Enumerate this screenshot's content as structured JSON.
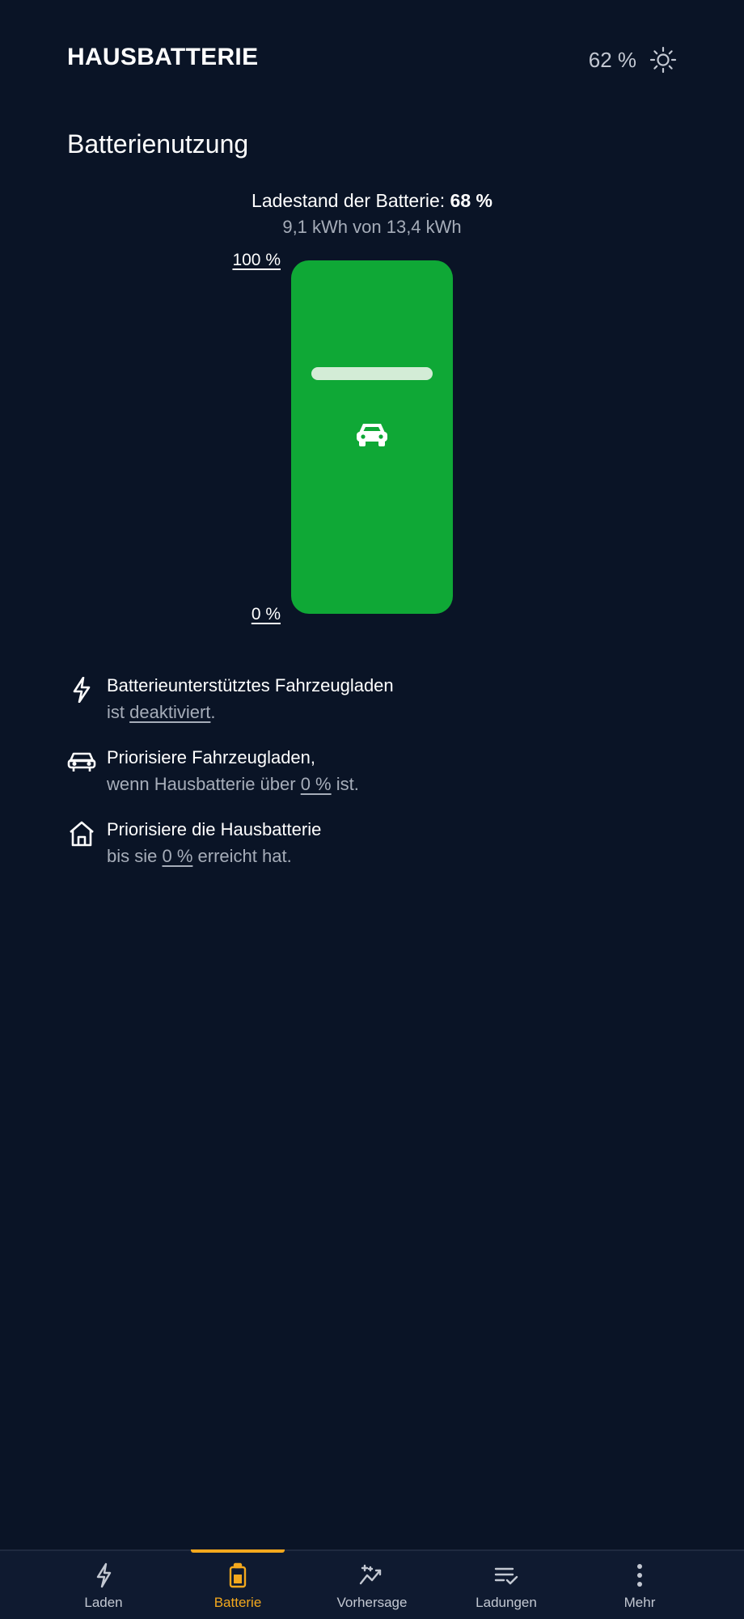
{
  "header": {
    "title": "HAUSBATTERIE",
    "level": "62 %",
    "settings_icon": "sun-icon"
  },
  "section_title": "Batterienutzung",
  "battery": {
    "label": "Ladestand der Batterie:",
    "percent": "68 %",
    "energy": "9,1 kWh von 13,4 kWh",
    "scale_top": "100 %",
    "scale_bottom": "0 %",
    "fill_color": "#0fa836",
    "threshold_level": 0.68,
    "icon": "car-icon"
  },
  "settings": [
    {
      "icon": "bolt-icon",
      "title": "Batterieunterstütztes Fahrzeugladen",
      "pre": "ist ",
      "link": "deaktiviert",
      "post": "."
    },
    {
      "icon": "car-icon",
      "title": "Priorisiere Fahrzeugladen,",
      "pre": "wenn Hausbatterie über ",
      "link": "0 %",
      "post": " ist."
    },
    {
      "icon": "home-icon",
      "title": "Priorisiere die Hausbatterie",
      "pre": "bis sie ",
      "link": "0 %",
      "post": " erreicht hat."
    }
  ],
  "nav": {
    "items": [
      {
        "label": "Laden",
        "icon": "bolt-icon"
      },
      {
        "label": "Batterie",
        "icon": "battery-icon",
        "active": true
      },
      {
        "label": "Vorhersage",
        "icon": "forecast-icon"
      },
      {
        "label": "Ladungen",
        "icon": "list-check-icon"
      },
      {
        "label": "Mehr",
        "icon": "more-vertical-icon"
      }
    ]
  },
  "colors": {
    "background": "#0a1426",
    "accent": "#f3a81d",
    "battery_green": "#0fa836",
    "muted_text": "#a6adb9"
  }
}
